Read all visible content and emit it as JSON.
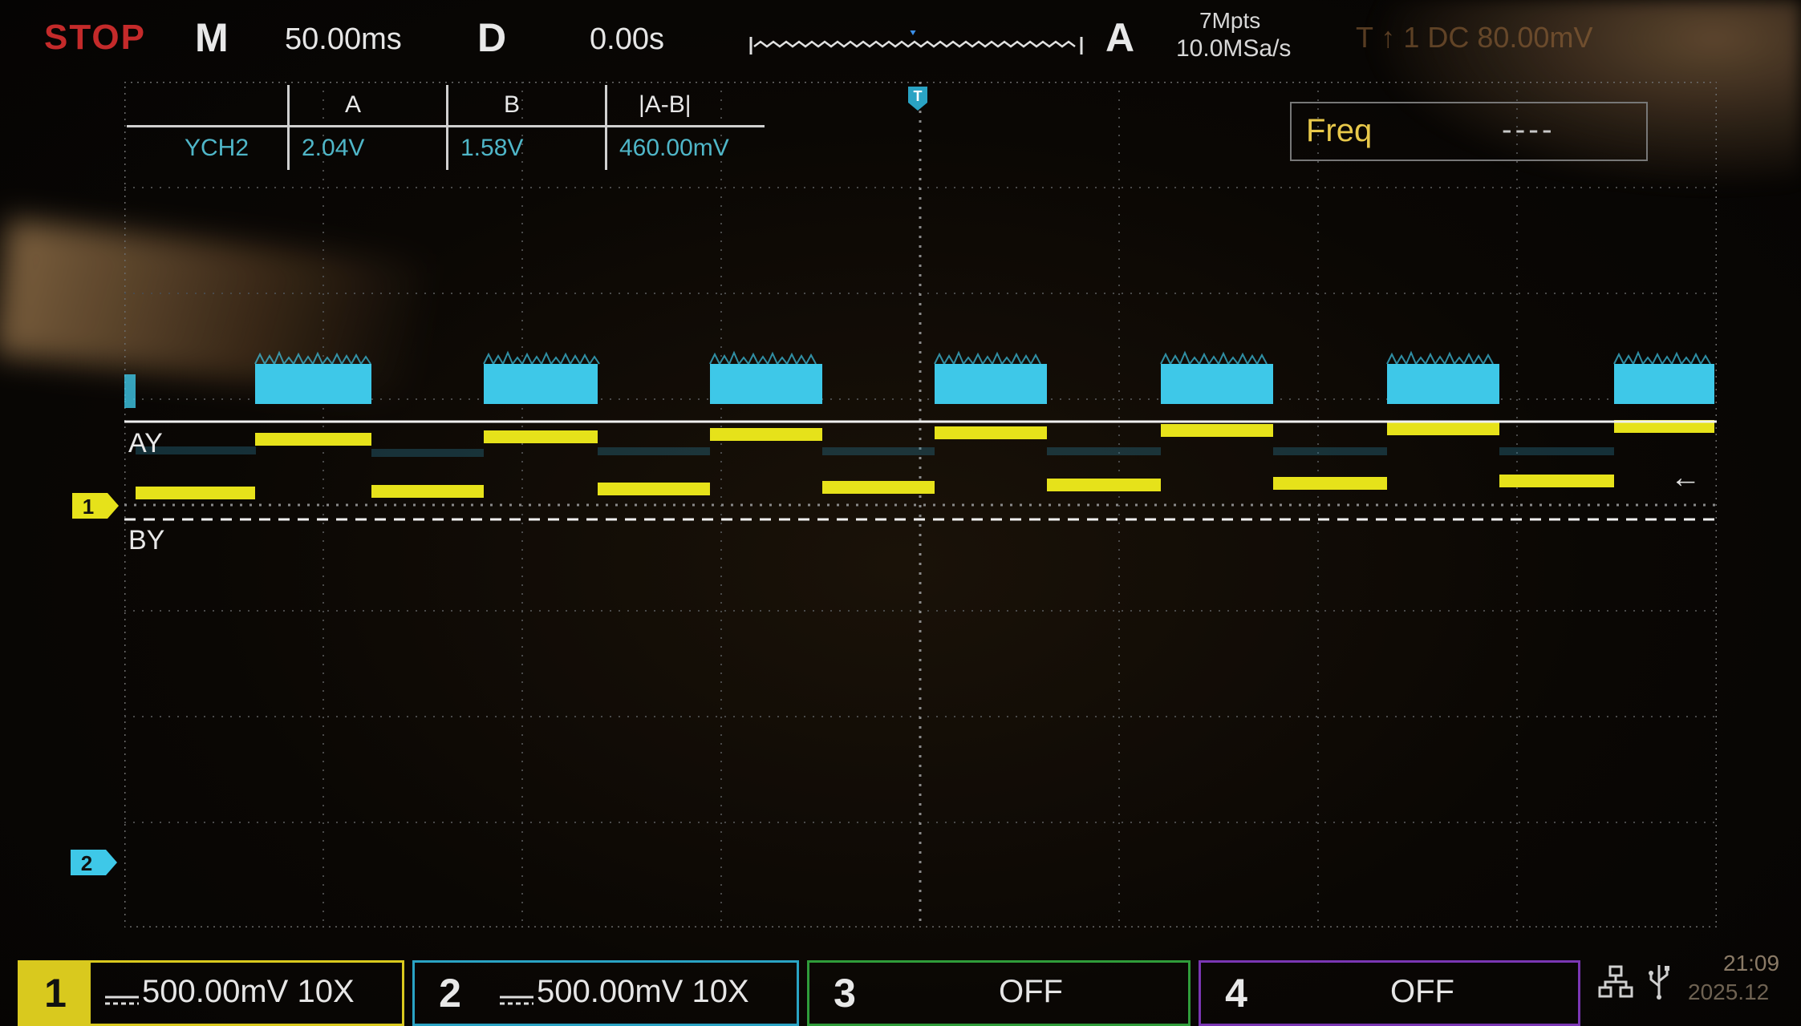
{
  "top_bar": {
    "run_state": "STOP",
    "timebase_label": "M",
    "timebase_value": "50.00ms",
    "delay_label": "D",
    "delay_value": "0.00s",
    "acquire_label": "A",
    "memory_depth": "7Mpts",
    "sample_rate": "10.0MSa/s",
    "trigger_info": "T  ↑  1  DC  80.00mV"
  },
  "cursor_table": {
    "headers": [
      "A",
      "B",
      "|A-B|"
    ],
    "row_label": "YCH2",
    "values": [
      "2.04V",
      "1.58V",
      "460.00mV"
    ]
  },
  "freq_box": {
    "label": "Freq",
    "value": "----"
  },
  "cursors": {
    "a_label": "AY",
    "b_label": "BY"
  },
  "channel_markers": {
    "ch1": "1",
    "ch2": "2",
    "trigger": "T"
  },
  "bottom_bar": {
    "ch1": {
      "number": "1",
      "setting": "500.00mV 10X",
      "color": "#d9c91e"
    },
    "ch2": {
      "number": "2",
      "setting": "500.00mV 10X",
      "color": "#2aa3c4"
    },
    "ch3": {
      "number": "3",
      "setting": "OFF",
      "color": "#2f9c3a"
    },
    "ch4": {
      "number": "4",
      "setting": "OFF",
      "color": "#7a36b4"
    },
    "time": "21:09",
    "date": "2025.12"
  },
  "colors": {
    "ch1": "#e6e21a",
    "ch2": "#3ec8e8",
    "grid": "#5a5a5a"
  },
  "icons": [
    "network-icon",
    "usb-icon",
    "trigger-position-icon",
    "trigger-level-arrow-icon"
  ]
}
